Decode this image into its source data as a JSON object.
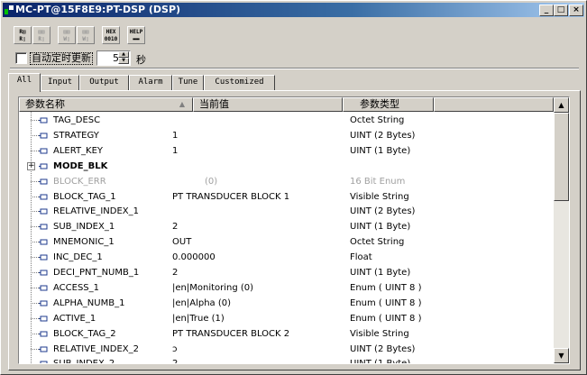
{
  "window": {
    "title": "MC-PT@15F8E9:PT-DSP (DSP)",
    "minimize": "_",
    "maximize": "□",
    "close": "×"
  },
  "toolbar": {
    "buttons": [
      {
        "icon": "read-param-icon",
        "top": "R▤",
        "bottom": "R▯",
        "enabled": true
      },
      {
        "icon": "read-all-icon",
        "top": "▤▤",
        "bottom": "R▯",
        "enabled": false
      },
      {
        "icon": "write-param-icon",
        "top": "▤▤",
        "bottom": "W▯",
        "enabled": false
      },
      {
        "icon": "write-all-icon",
        "top": "▤▤",
        "bottom": "W▯",
        "enabled": false
      },
      {
        "icon": "hex-icon",
        "top": "HEX",
        "bottom": "0010",
        "enabled": true
      },
      {
        "icon": "help-icon",
        "top": "HELP",
        "bottom": "▬▬",
        "enabled": true
      }
    ]
  },
  "auto_update": {
    "label": "自动定时更新",
    "checked": false,
    "interval": "5",
    "unit": "秒"
  },
  "tabs": [
    {
      "label": "All",
      "active": true
    },
    {
      "label": "Input",
      "active": false
    },
    {
      "label": "Output",
      "active": false
    },
    {
      "label": "Alarm",
      "active": false
    },
    {
      "label": "Tune",
      "active": false
    },
    {
      "label": "Customized",
      "active": false
    }
  ],
  "list": {
    "headers": {
      "name": "参数名称",
      "value": "当前值",
      "type": "参数类型"
    },
    "rows": [
      {
        "name": "TAG_DESC",
        "value": "",
        "type": "Octet String",
        "style": ""
      },
      {
        "name": "STRATEGY",
        "value": "1",
        "type": "UINT (2 Bytes)",
        "style": ""
      },
      {
        "name": "ALERT_KEY",
        "value": "1",
        "type": "UINT (1 Byte)",
        "style": ""
      },
      {
        "name": "MODE_BLK",
        "value": "",
        "type": "",
        "style": "bold"
      },
      {
        "name": "BLOCK_ERR",
        "value": "(0)",
        "type": "16 Bit Enum",
        "style": "gray"
      },
      {
        "name": "BLOCK_TAG_1",
        "value": "PT TRANSDUCER BLOCK 1",
        "type": "Visible String",
        "style": ""
      },
      {
        "name": "RELATIVE_INDEX_1",
        "value": "",
        "type": "UINT (2 Bytes)",
        "style": ""
      },
      {
        "name": "SUB_INDEX_1",
        "value": "2",
        "type": "UINT (1 Byte)",
        "style": ""
      },
      {
        "name": "MNEMONIC_1",
        "value": "OUT",
        "type": "Octet String",
        "style": ""
      },
      {
        "name": "INC_DEC_1",
        "value": "0.000000",
        "type": "Float",
        "style": ""
      },
      {
        "name": "DECI_PNT_NUMB_1",
        "value": "2",
        "type": "UINT (1 Byte)",
        "style": ""
      },
      {
        "name": "ACCESS_1",
        "value": "|en|Monitoring      (0)",
        "type": "Enum ( UINT 8 )",
        "style": ""
      },
      {
        "name": "ALPHA_NUMB_1",
        "value": "|en|Alpha      (0)",
        "type": "Enum ( UINT 8 )",
        "style": ""
      },
      {
        "name": "ACTIVE_1",
        "value": "|en|True      (1)",
        "type": "Enum ( UINT 8 )",
        "style": ""
      },
      {
        "name": "BLOCK_TAG_2",
        "value": "PT TRANSDUCER BLOCK 2",
        "type": "Visible String",
        "style": ""
      },
      {
        "name": "RELATIVE_INDEX_2",
        "value": "ɔ",
        "type": "UINT (2 Bytes)",
        "style": ""
      },
      {
        "name": "SUB_INDEX_2",
        "value": "2",
        "type": "UINT (1 Byte)",
        "style": ""
      }
    ]
  },
  "scrollbar": {
    "up": "▲",
    "down": "▼"
  },
  "colors": {
    "title_start": "#0a246a",
    "title_end": "#a6caf0",
    "face": "#d4d0c8",
    "disabled_text": "#a0a0a0"
  }
}
